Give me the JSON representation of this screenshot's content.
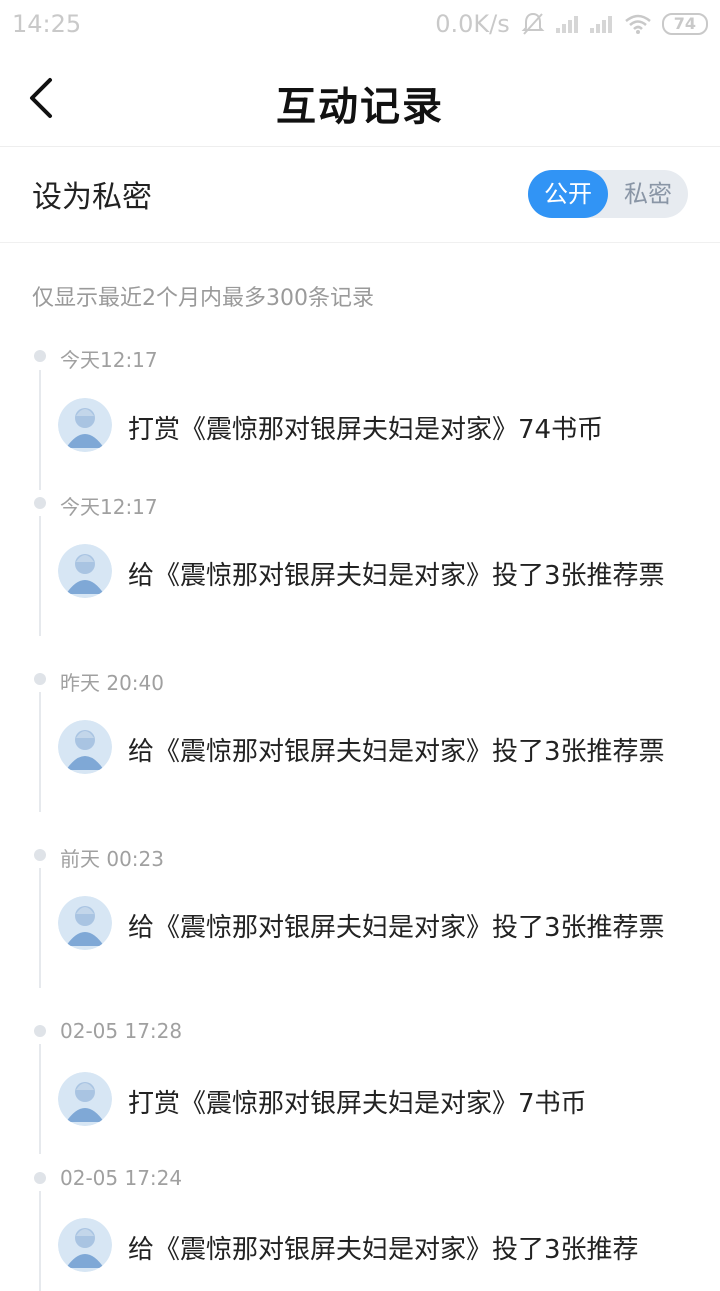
{
  "status_bar": {
    "time": "14:25",
    "network_speed": "0.0K/s",
    "battery": "74",
    "icons": [
      "mute-bell-icon",
      "signal-icon",
      "signal-icon",
      "wifi-icon",
      "battery-icon"
    ]
  },
  "nav": {
    "title": "互动记录",
    "back_icon": "chevron-left-icon"
  },
  "privacy": {
    "label": "设为私密",
    "options": [
      "公开",
      "私密"
    ],
    "selected": "公开",
    "accent": "#3194f5"
  },
  "notice": "仅显示最近2个月内最多300条记录",
  "records": [
    {
      "time": "今天12:17",
      "text": "打赏《震惊那对银屏夫妇是对家》74书币"
    },
    {
      "time": "今天12:17",
      "text": "给《震惊那对银屏夫妇是对家》投了3张推荐票"
    },
    {
      "time": "昨天 20:40",
      "text": "给《震惊那对银屏夫妇是对家》投了3张推荐票"
    },
    {
      "time": "前天 00:23",
      "text": "给《震惊那对银屏夫妇是对家》投了3张推荐票"
    },
    {
      "time": "02-05 17:28",
      "text": "打赏《震惊那对银屏夫妇是对家》7书币"
    },
    {
      "time": "02-05 17:24",
      "text": "给《震惊那对银屏夫妇是对家》投了3张推荐"
    }
  ]
}
